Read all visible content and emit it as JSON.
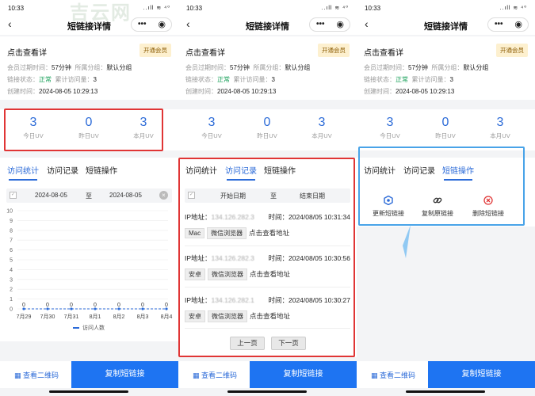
{
  "watermark": "吉云网",
  "statusbar": {
    "time": "10:33",
    "signal": "..ıll ≋ ⁴⁰"
  },
  "page_title": "短链接详情",
  "link_info": {
    "name": "点击查看详",
    "vip_button": "开通会员",
    "expire_label": "会员过期时间：",
    "expire_value": "57分钟",
    "group_label": "所属分组：",
    "group_value": "默认分组",
    "status_label": "链接状态：",
    "status_value": "正常",
    "visits_label": "累计访问量：",
    "visits_value": "3",
    "created_label": "创建时间：",
    "created_value": "2024-08-05 10:29:13"
  },
  "uv": [
    {
      "num": "3",
      "label": "今日UV"
    },
    {
      "num": "0",
      "label": "昨日UV"
    },
    {
      "num": "3",
      "label": "本月UV"
    }
  ],
  "tabs": [
    "访问统计",
    "访问记录",
    "短链操作"
  ],
  "stats_filter": {
    "start": "2024-08-05",
    "to": "至",
    "end": "2024-08-05"
  },
  "records_filter": {
    "start": "开始日期",
    "to": "至",
    "end": "结束日期"
  },
  "chart_data": {
    "type": "line",
    "categories": [
      "7月29",
      "7月30",
      "7月31",
      "8月1",
      "8月2",
      "8月3",
      "8月4"
    ],
    "series": [
      {
        "name": "访问人数",
        "values": [
          0,
          0,
          0,
          0,
          0,
          0,
          0
        ]
      }
    ],
    "ylim": [
      0,
      10
    ],
    "yticks": [
      "10",
      "9",
      "8",
      "7",
      "6",
      "5",
      "4",
      "3",
      "2",
      "1",
      "0"
    ],
    "legend": "bottom",
    "series_color": "#2c6bd8"
  },
  "records": [
    {
      "ip_label": "IP地址：",
      "ip": "134.126.282.3",
      "time_label": "时间：",
      "time": "2024/08/05 10:31:34",
      "os": "Mac",
      "browser": "微信浏览器",
      "addr": "点击查看地址"
    },
    {
      "ip_label": "IP地址：",
      "ip": "134.126.282.3",
      "time_label": "时间：",
      "time": "2024/08/05 10:30:56",
      "os": "安卓",
      "browser": "微信浏览器",
      "addr": "点击查看地址"
    },
    {
      "ip_label": "IP地址：",
      "ip": "134.126.282.1",
      "time_label": "时间：",
      "time": "2024/08/05 10:30:27",
      "os": "安卓",
      "browser": "微信浏览器",
      "addr": "点击查看地址"
    }
  ],
  "pager": {
    "prev": "上一页",
    "next": "下一页"
  },
  "operations": [
    {
      "icon": "refresh-hex-icon",
      "label": "更新短链接",
      "color": "#2c6bd8"
    },
    {
      "icon": "link-icon",
      "label": "复制原链接",
      "color": "#333333"
    },
    {
      "icon": "delete-circle-icon",
      "label": "删除短链接",
      "color": "#e03535"
    }
  ],
  "bottom_bar": {
    "qr_label": "查看二维码",
    "copy_label": "复制短链接"
  },
  "colors": {
    "accent": "#2c6bd8",
    "button": "#1e74f2",
    "highlight_red": "#e03535",
    "highlight_blue": "#48a3e8"
  }
}
